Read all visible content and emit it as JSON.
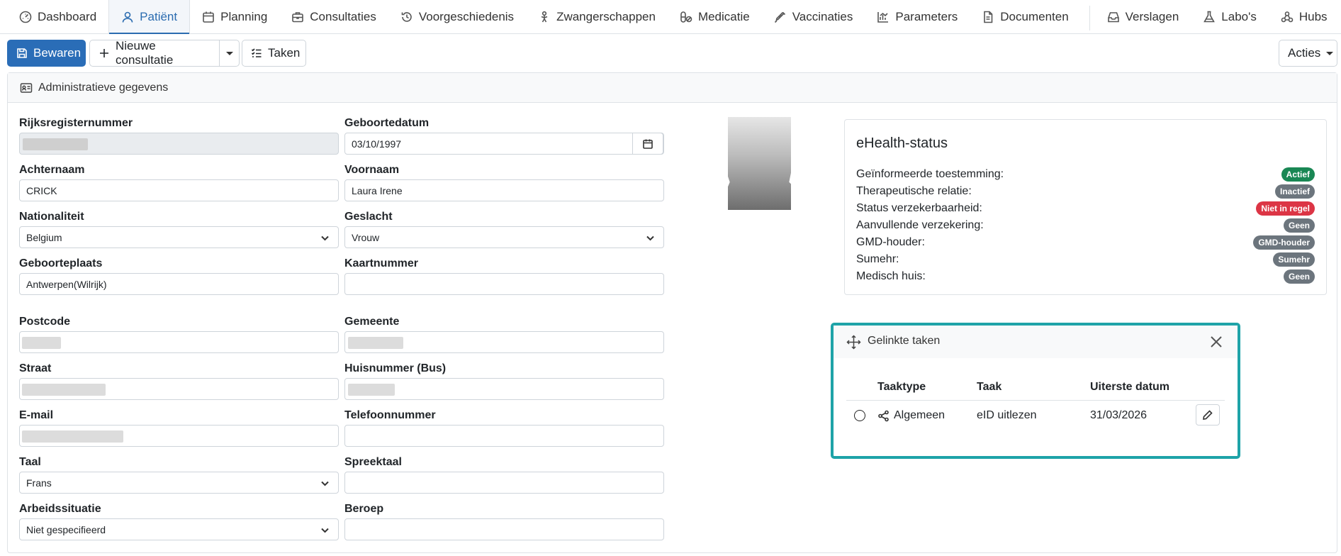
{
  "nav": {
    "tabs": [
      {
        "label": "Dashboard",
        "icon": "dashboard-icon"
      },
      {
        "label": "Patiënt",
        "icon": "user-icon",
        "active": true
      },
      {
        "label": "Planning",
        "icon": "calendar-icon"
      },
      {
        "label": "Consultaties",
        "icon": "briefcase-icon"
      },
      {
        "label": "Voorgeschiedenis",
        "icon": "history-icon"
      },
      {
        "label": "Zwangerschappen",
        "icon": "baby-icon"
      },
      {
        "label": "Medicatie",
        "icon": "pills-icon"
      },
      {
        "label": "Vaccinaties",
        "icon": "syringe-icon"
      },
      {
        "label": "Parameters",
        "icon": "chart-icon"
      },
      {
        "label": "Documenten",
        "icon": "document-icon"
      }
    ],
    "right_tabs": [
      {
        "label": "Verslagen",
        "icon": "inbox-icon"
      },
      {
        "label": "Labo's",
        "icon": "flask-icon"
      },
      {
        "label": "Hubs",
        "icon": "hubs-icon"
      }
    ]
  },
  "toolbar": {
    "save_label": "Bewaren",
    "new_consult_label": "Nieuwe consultatie",
    "tasks_label": "Taken",
    "actions_label": "Acties"
  },
  "admin": {
    "title": "Administratieve gegevens",
    "fields": {
      "rijksregister": {
        "label": "Rijksregisternummer",
        "value": ""
      },
      "geboortedatum": {
        "label": "Geboortedatum",
        "value": "03/10/1997"
      },
      "achternaam": {
        "label": "Achternaam",
        "value": "CRICK"
      },
      "voornaam": {
        "label": "Voornaam",
        "value": "Laura Irene"
      },
      "nationaliteit": {
        "label": "Nationaliteit",
        "value": "Belgium"
      },
      "geslacht": {
        "label": "Geslacht",
        "value": "Vrouw"
      },
      "geboorteplaats": {
        "label": "Geboorteplaats",
        "value": "Antwerpen(Wilrijk)"
      },
      "kaartnummer": {
        "label": "Kaartnummer",
        "value": ""
      },
      "postcode": {
        "label": "Postcode",
        "value": ""
      },
      "gemeente": {
        "label": "Gemeente",
        "value": ""
      },
      "straat": {
        "label": "Straat",
        "value": ""
      },
      "huisnummer": {
        "label": "Huisnummer (Bus)",
        "value": ""
      },
      "email": {
        "label": "E-mail",
        "value": ""
      },
      "telefoon": {
        "label": "Telefoonnummer",
        "value": ""
      },
      "taal": {
        "label": "Taal",
        "value": "Frans"
      },
      "spreektaal": {
        "label": "Spreektaal",
        "value": ""
      },
      "arbeidssituatie": {
        "label": "Arbeidssituatie",
        "value": "Niet gespecifieerd"
      },
      "beroep": {
        "label": "Beroep",
        "value": ""
      }
    }
  },
  "ehealth": {
    "title": "eHealth-status",
    "rows": [
      {
        "label": "Geïnformeerde toestemming:",
        "badge": "Actief",
        "color": "#198754"
      },
      {
        "label": "Therapeutische relatie:",
        "badge": "Inactief",
        "color": "#6c757d"
      },
      {
        "label": "Status verzekerbaarheid:",
        "badge": "Niet in regel",
        "color": "#dc3545"
      },
      {
        "label": "Aanvullende verzekering:",
        "badge": "Geen",
        "color": "#6c757d"
      },
      {
        "label": "GMD-houder:",
        "badge": "GMD-houder",
        "color": "#6c757d"
      },
      {
        "label": "Sumehr:",
        "badge": "Sumehr",
        "color": "#6c757d"
      },
      {
        "label": "Medisch huis:",
        "badge": "Geen",
        "color": "#6c757d"
      }
    ]
  },
  "linked_tasks": {
    "title": "Gelinkte taken",
    "columns": [
      "Taaktype",
      "Taak",
      "Uiterste datum"
    ],
    "rows": [
      {
        "type": "Algemeen",
        "task": "eID uitlezen",
        "due": "31/03/2026"
      }
    ]
  },
  "colors": {
    "primary": "#2a6db7",
    "highlight_border": "#1ea3a8"
  }
}
